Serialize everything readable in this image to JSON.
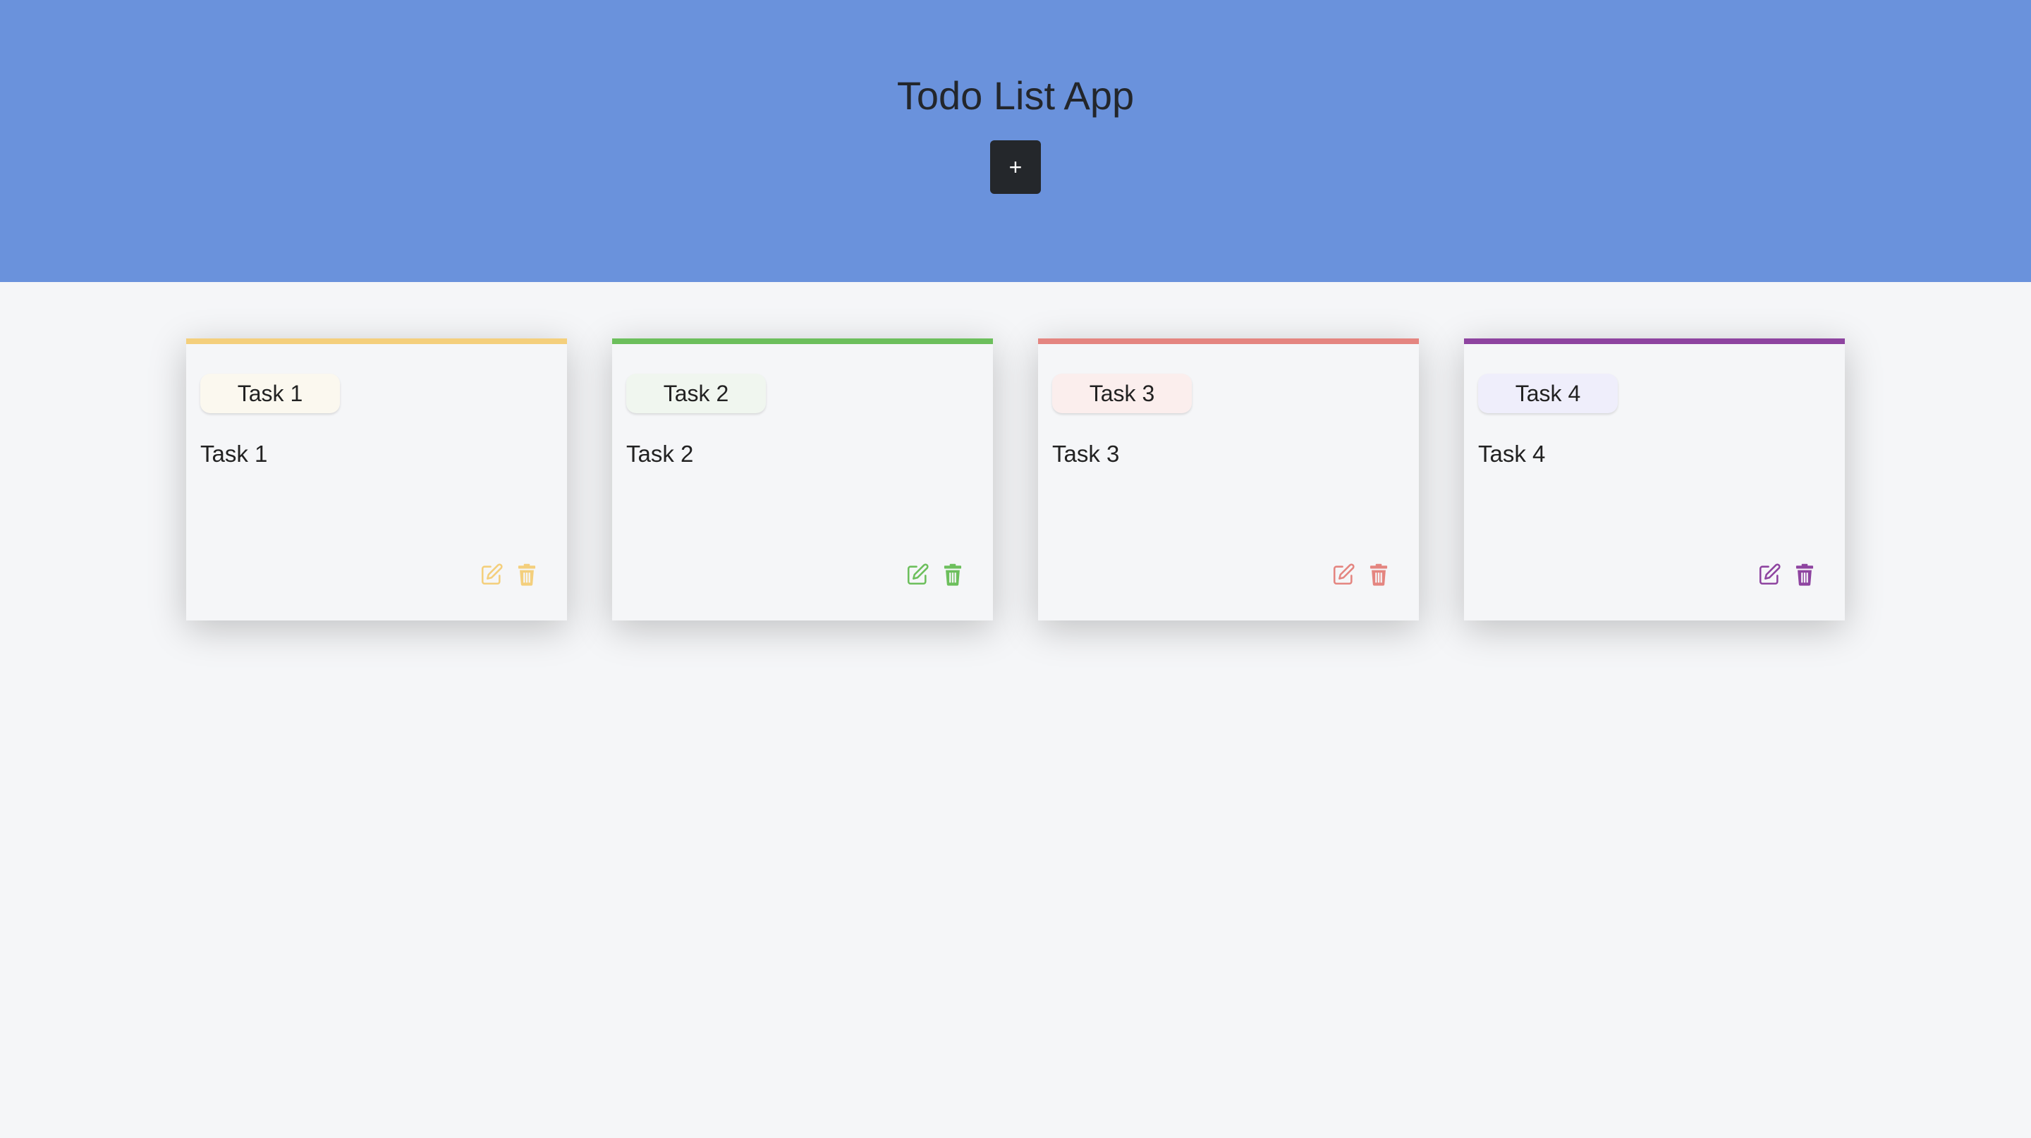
{
  "header": {
    "title": "Todo List App",
    "add_label": "+",
    "background": "#6a92dc"
  },
  "tasks": [
    {
      "tag": "Task 1",
      "text": "Task 1",
      "accent": "#f4cf7c",
      "tag_bg": "#fbf8ef"
    },
    {
      "tag": "Task 2",
      "text": "Task 2",
      "accent": "#6cbf5c",
      "tag_bg": "#f0f6ef"
    },
    {
      "tag": "Task 3",
      "text": "Task 3",
      "accent": "#e48580",
      "tag_bg": "#fbeeed"
    },
    {
      "tag": "Task 4",
      "text": "Task 4",
      "accent": "#8e44a0",
      "tag_bg": "#efeefb"
    }
  ],
  "icons": {
    "edit": "edit-icon",
    "delete": "trash-icon"
  }
}
